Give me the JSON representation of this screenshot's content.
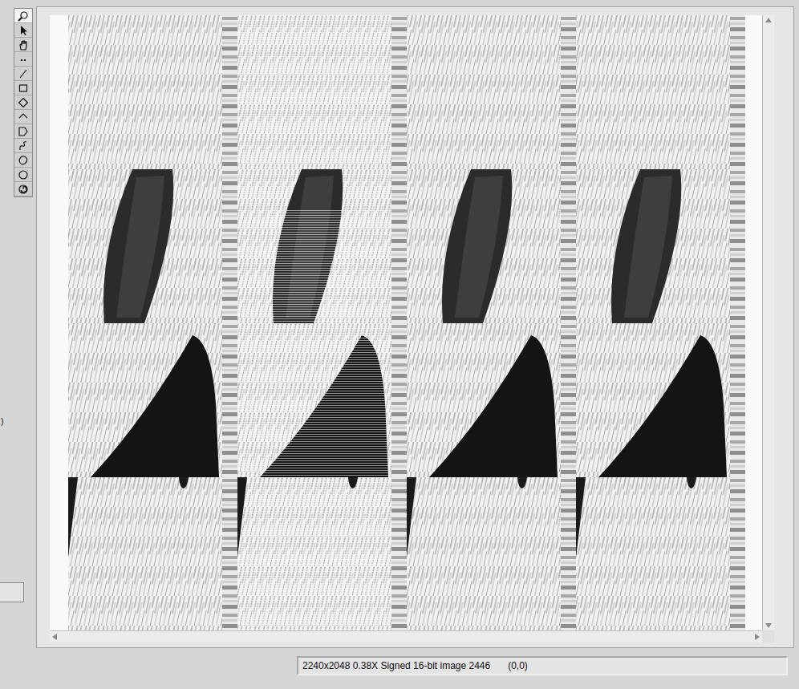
{
  "toolbar": {
    "tools": [
      {
        "kind": "zoom",
        "selected": true
      },
      {
        "kind": "select",
        "selected": false
      },
      {
        "kind": "pan",
        "selected": false
      },
      {
        "kind": "point",
        "selected": false
      },
      {
        "kind": "line",
        "selected": false
      },
      {
        "kind": "rectangle",
        "selected": false
      },
      {
        "kind": "rotated-rectangle",
        "selected": false
      },
      {
        "kind": "broken-line",
        "selected": false
      },
      {
        "kind": "polygon",
        "selected": false
      },
      {
        "kind": "freehand-line",
        "selected": false
      },
      {
        "kind": "freehand-region",
        "selected": false
      },
      {
        "kind": "oval",
        "selected": false
      },
      {
        "kind": "annulus",
        "selected": false
      }
    ]
  },
  "side_label": ")",
  "image_display": {
    "tiles": {
      "columns": 4,
      "rows": 4
    }
  },
  "status_bar": {
    "info": "2240x2048 0.38X Signed 16-bit image 2446",
    "coords": "(0,0)"
  }
}
